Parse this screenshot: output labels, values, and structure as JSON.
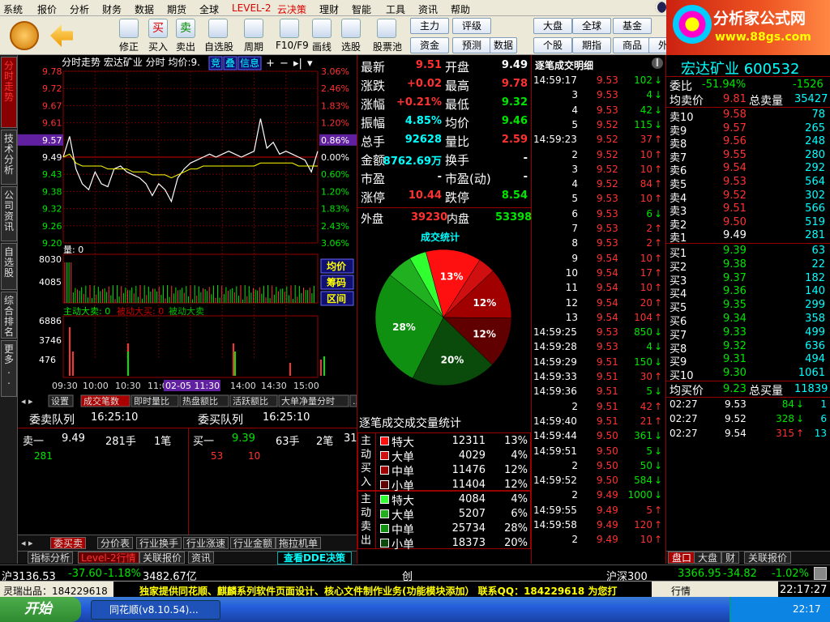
{
  "menu": [
    "系统",
    "报价",
    "分析",
    "财务",
    "数据",
    "期货",
    "全球",
    "LEVEL-2",
    "云决策",
    "理财",
    "智能",
    "工具",
    "资讯",
    "帮助"
  ],
  "toolbar": {
    "buttons": [
      {
        "label": "修正",
        "icon": "arrow-up-down-icon"
      },
      {
        "label": "买入",
        "icon": "buy-icon",
        "glyph": "买"
      },
      {
        "label": "卖出",
        "icon": "sell-icon",
        "glyph": "卖"
      },
      {
        "label": "自选股",
        "icon": "star-icon"
      },
      {
        "label": "周期",
        "icon": "clock-icon"
      },
      {
        "label": "F10/F9",
        "icon": "f10-icon"
      },
      {
        "label": "画线",
        "icon": "pencil-icon"
      },
      {
        "label": "选股",
        "icon": "select-icon"
      },
      {
        "label": "股票池",
        "icon": "pool-icon"
      }
    ],
    "quick": [
      "主力",
      "评级",
      "大盘",
      "全球",
      "基金",
      "资金",
      "预测",
      "个股",
      "期指",
      "商品",
      "外汇",
      "美股",
      "数据"
    ]
  },
  "logo": {
    "title": "分析家公式网",
    "url": "www.88gs.com"
  },
  "left_tabs": [
    "分时走势",
    "技术分析",
    "公司资讯",
    "自选股",
    "综合排名",
    "更多.."
  ],
  "chart": {
    "header": {
      "title": "分时走势",
      "name": "宏达矿业",
      "mode": "分时",
      "avg_label": "均价:",
      "avg_val": "9.",
      "btns": [
        "竞",
        "叠",
        "信息"
      ]
    },
    "price_ticks": [
      "9.78",
      "9.72",
      "9.67",
      "9.61",
      "9.55",
      "9.49",
      "9.43",
      "9.38",
      "9.32",
      "9.26",
      "9.20"
    ],
    "pct_ticks": [
      "3.06%",
      "2.46%",
      "1.83%",
      "1.20%",
      "0.60%",
      "0.00%",
      "0.60%",
      "1.20%",
      "1.83%",
      "2.43%",
      "3.06%"
    ],
    "highlight_price": "9.57",
    "highlight_pct": "0.86%",
    "vol_label": "量: 0",
    "vol_ticks": [
      "8030",
      "4085"
    ],
    "side_btns": [
      "均价",
      "筹码",
      "区间"
    ],
    "active_label": "主动大卖: 0",
    "passive_buy_label": "被动大买: 0",
    "passive_sell_label": "被动大卖",
    "flow_ticks": [
      "6886",
      "3746",
      "476"
    ],
    "time_ticks": [
      "09:30",
      "10:00",
      "10:30",
      "11:00",
      "02-05 11:30",
      "14:00",
      "14:30",
      "15:00"
    ],
    "bottom_tabs": [
      "设置",
      "成交笔数",
      "即时量比",
      "热盘额比",
      "活跃额比",
      "大单净量分时",
      "..."
    ]
  },
  "queues": {
    "sell_title": "委卖队列",
    "sell_time": "16:25:10",
    "buy_title": "委买队列",
    "buy_time": "16:25:10",
    "sell_row": {
      "label": "卖一",
      "price": "9.49",
      "hands": "281手",
      "count": "1笔",
      "first": "281"
    },
    "buy_row": {
      "label": "买一",
      "price": "9.39",
      "hands": "63手",
      "count": "2笔",
      "extra": "31",
      "v1": "53",
      "v2": "10"
    },
    "tabs": [
      "委买卖",
      "分价表",
      "行业换手",
      "行业涨速",
      "行业金额",
      "拖拉机单"
    ],
    "tabs2": [
      "指标分析",
      "Level-2行情",
      "关联报价",
      "资讯"
    ],
    "dde_btn": "查看DDE决策"
  },
  "quote": {
    "rows": [
      {
        "l": "最新",
        "v": "9.51",
        "vc": "red",
        "l2": "开盘",
        "v2": "9.49",
        "v2c": "wht"
      },
      {
        "l": "涨跌",
        "v": "+0.02",
        "vc": "red",
        "l2": "最高",
        "v2": "9.78",
        "v2c": "red"
      },
      {
        "l": "涨幅",
        "v": "+0.21%",
        "vc": "red",
        "l2": "最低",
        "v2": "9.32",
        "v2c": "grn"
      },
      {
        "l": "振幅",
        "v": "4.85%",
        "vc": "cyan",
        "l2": "均价",
        "v2": "9.46",
        "v2c": "grn"
      },
      {
        "l": "总手",
        "v": "92628",
        "vc": "cyan",
        "l2": "量比",
        "v2": "2.59",
        "v2c": "red"
      },
      {
        "l": "金额",
        "v": "8762.69万",
        "vc": "cyan",
        "l2": "换手",
        "v2": "-",
        "v2c": "wht"
      },
      {
        "l": "市盈",
        "v": "-",
        "vc": "wht",
        "l2": "市盈(动)",
        "v2": "-",
        "v2c": "wht"
      },
      {
        "l": "涨停",
        "v": "10.44",
        "vc": "red",
        "l2": "跌停",
        "v2": "8.54",
        "v2c": "grn"
      }
    ],
    "outer": {
      "l": "外盘",
      "v": "39230",
      "l2": "内盘",
      "v2": "53398"
    }
  },
  "deal_stats": {
    "title": "成交统计",
    "subtitle": "逐笔成交成交量统计",
    "slices": [
      {
        "pct": 13,
        "label": "13%",
        "color": "#ff1010"
      },
      {
        "pct": 4,
        "label": "",
        "color": "#d01010"
      },
      {
        "pct": 12,
        "label": "12%",
        "color": "#a00000"
      },
      {
        "pct": 12,
        "label": "12%",
        "color": "#600000"
      },
      {
        "pct": 20,
        "label": "20%",
        "color": "#0a4a0a"
      },
      {
        "pct": 28,
        "label": "28%",
        "color": "#109010"
      },
      {
        "pct": 6,
        "label": "",
        "color": "#20b020"
      },
      {
        "pct": 4,
        "label": "",
        "color": "#30ff30"
      }
    ],
    "buy_group": "主动买入",
    "sell_group": "主动卖出",
    "buy": [
      {
        "n": "特大",
        "v": "12311",
        "p": "13%",
        "c": "#ff1010"
      },
      {
        "n": "大单",
        "v": "4029",
        "p": "4%",
        "c": "#d01010"
      },
      {
        "n": "中单",
        "v": "11476",
        "p": "12%",
        "c": "#a00000"
      },
      {
        "n": "小单",
        "v": "11404",
        "p": "12%",
        "c": "#600000"
      }
    ],
    "sell": [
      {
        "n": "特大",
        "v": "4084",
        "p": "4%",
        "c": "#30ff30"
      },
      {
        "n": "大单",
        "v": "5207",
        "p": "6%",
        "c": "#20b020"
      },
      {
        "n": "中单",
        "v": "25734",
        "p": "28%",
        "c": "#109010"
      },
      {
        "n": "小单",
        "v": "18373",
        "p": "20%",
        "c": "#0a4a0a"
      }
    ]
  },
  "ticks": {
    "title": "逐笔成交明细",
    "rows": [
      {
        "t": "14:59:17",
        "p": "9.53",
        "v": "102",
        "d": "down"
      },
      {
        "t": "3",
        "p": "9.53",
        "v": "4",
        "d": "down"
      },
      {
        "t": "4",
        "p": "9.53",
        "v": "42",
        "d": "down"
      },
      {
        "t": "5",
        "p": "9.52",
        "v": "115",
        "d": "down"
      },
      {
        "t": "14:59:23",
        "p": "9.52",
        "v": "37",
        "d": "up"
      },
      {
        "t": "2",
        "p": "9.52",
        "v": "10",
        "d": "up"
      },
      {
        "t": "3",
        "p": "9.52",
        "v": "10",
        "d": "up"
      },
      {
        "t": "4",
        "p": "9.52",
        "v": "84",
        "d": "up"
      },
      {
        "t": "5",
        "p": "9.53",
        "v": "10",
        "d": "up"
      },
      {
        "t": "6",
        "p": "9.53",
        "v": "6",
        "d": "down"
      },
      {
        "t": "7",
        "p": "9.53",
        "v": "2",
        "d": "up"
      },
      {
        "t": "8",
        "p": "9.53",
        "v": "2",
        "d": "up"
      },
      {
        "t": "9",
        "p": "9.54",
        "v": "10",
        "d": "up"
      },
      {
        "t": "10",
        "p": "9.54",
        "v": "17",
        "d": "up"
      },
      {
        "t": "11",
        "p": "9.54",
        "v": "10",
        "d": "up"
      },
      {
        "t": "12",
        "p": "9.54",
        "v": "20",
        "d": "up"
      },
      {
        "t": "13",
        "p": "9.54",
        "v": "104",
        "d": "up"
      },
      {
        "t": "14:59:25",
        "p": "9.53",
        "v": "850",
        "d": "down"
      },
      {
        "t": "14:59:28",
        "p": "9.53",
        "v": "4",
        "d": "down"
      },
      {
        "t": "14:59:29",
        "p": "9.51",
        "v": "150",
        "d": "down"
      },
      {
        "t": "14:59:33",
        "p": "9.51",
        "v": "30",
        "d": "up"
      },
      {
        "t": "14:59:36",
        "p": "9.51",
        "v": "5",
        "d": "down"
      },
      {
        "t": "2",
        "p": "9.51",
        "v": "42",
        "d": "up"
      },
      {
        "t": "14:59:40",
        "p": "9.51",
        "v": "21",
        "d": "up"
      },
      {
        "t": "14:59:44",
        "p": "9.50",
        "v": "361",
        "d": "down"
      },
      {
        "t": "14:59:51",
        "p": "9.50",
        "v": "5",
        "d": "down"
      },
      {
        "t": "2",
        "p": "9.50",
        "v": "50",
        "d": "down"
      },
      {
        "t": "14:59:52",
        "p": "9.50",
        "v": "584",
        "d": "down"
      },
      {
        "t": "2",
        "p": "9.49",
        "v": "1000",
        "d": "down"
      },
      {
        "t": "14:59:55",
        "p": "9.49",
        "v": "5",
        "d": "up"
      },
      {
        "t": "14:59:58",
        "p": "9.49",
        "v": "120",
        "d": "up"
      },
      {
        "t": "2",
        "p": "9.49",
        "v": "10",
        "d": "up"
      }
    ]
  },
  "book": {
    "stock": "宏达矿业 600532",
    "weibi": {
      "l": "委比",
      "v": "-51.94%",
      "v2": "-1526"
    },
    "sell_avg": {
      "l": "均卖价",
      "v": "9.81",
      "l2": "总卖量",
      "v2": "35427"
    },
    "asks": [
      {
        "l": "卖10",
        "p": "9.58",
        "v": "78"
      },
      {
        "l": "卖9",
        "p": "9.57",
        "v": "265"
      },
      {
        "l": "卖8",
        "p": "9.56",
        "v": "248"
      },
      {
        "l": "卖7",
        "p": "9.55",
        "v": "280"
      },
      {
        "l": "卖6",
        "p": "9.54",
        "v": "292"
      },
      {
        "l": "卖5",
        "p": "9.53",
        "v": "564"
      },
      {
        "l": "卖4",
        "p": "9.52",
        "v": "302"
      },
      {
        "l": "卖3",
        "p": "9.51",
        "v": "566"
      },
      {
        "l": "卖2",
        "p": "9.50",
        "v": "519"
      },
      {
        "l": "卖1",
        "p": "9.49",
        "v": "281"
      }
    ],
    "bids": [
      {
        "l": "买1",
        "p": "9.39",
        "v": "63"
      },
      {
        "l": "买2",
        "p": "9.38",
        "v": "22"
      },
      {
        "l": "买3",
        "p": "9.37",
        "v": "182"
      },
      {
        "l": "买4",
        "p": "9.36",
        "v": "140"
      },
      {
        "l": "买5",
        "p": "9.35",
        "v": "299"
      },
      {
        "l": "买6",
        "p": "9.34",
        "v": "358"
      },
      {
        "l": "买7",
        "p": "9.33",
        "v": "499"
      },
      {
        "l": "买8",
        "p": "9.32",
        "v": "636"
      },
      {
        "l": "买9",
        "p": "9.31",
        "v": "494"
      },
      {
        "l": "买10",
        "p": "9.30",
        "v": "1061"
      }
    ],
    "buy_avg": {
      "l": "均买价",
      "v": "9.23",
      "l2": "总买量",
      "v2": "11839"
    },
    "recent": [
      {
        "t": "02:27",
        "p": "9.53",
        "v": "84",
        "d": "down",
        "n": "1"
      },
      {
        "t": "02:27",
        "p": "9.52",
        "v": "328",
        "d": "down",
        "n": "6"
      },
      {
        "t": "02:27",
        "p": "9.54",
        "v": "315",
        "d": "up",
        "n": "13"
      }
    ]
  },
  "right_tabs": [
    "盘口",
    "大盘",
    "财",
    "关联报价"
  ],
  "status": {
    "sh": "沪3136.53",
    "sh_chg": "-37.60",
    "sh_pct": "-1.18%",
    "sh_amt": "3482.67亿",
    "cy": "创",
    "hs": "沪深300",
    "hs_v": "3366.95",
    "hs_chg": "-34.82",
    "hs_pct": "-1.02%"
  },
  "status2": {
    "left": "灵瑞出品：184229618",
    "ticker": "独家提供同花顺、麒麟系列软件页面设计、核心文件制作业务(功能模块添加） 联系QQ：184229618 为您打",
    "info": "行情",
    "time": "22:17:27"
  },
  "taskbar": {
    "start": "开始",
    "app": "同花顺(v8.10.54)...",
    "clock": "22:17"
  }
}
